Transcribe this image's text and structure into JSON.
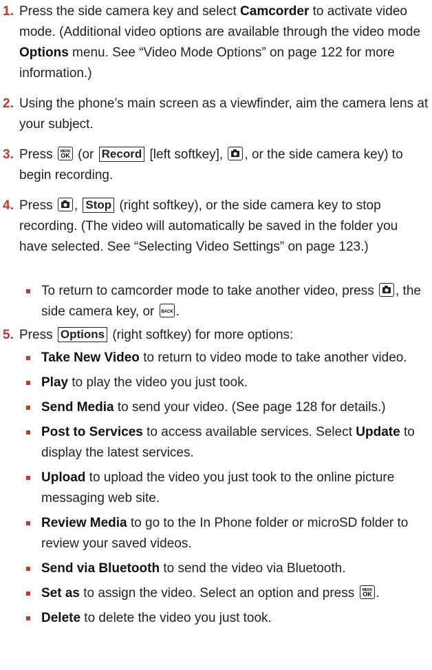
{
  "colors": {
    "accent": "#c0392b",
    "text": "#222222"
  },
  "icons": {
    "menu_ok": "menu-ok-key-icon",
    "camera": "camera-key-icon",
    "back": "back-key-icon"
  },
  "steps": [
    {
      "num": "1.",
      "a": "Press the side camera key and select ",
      "b": "Camcorder",
      "c": " to activate video mode. (Additional video options are available through the video mode ",
      "d": "Options",
      "e": " menu. See “Video Mode Options” on page 122 for more information.)"
    },
    {
      "num": "2.",
      "a": "Using the phone’s main screen as a viewfinder, aim the camera lens at your subject."
    },
    {
      "num": "3.",
      "a": "Press ",
      "b": " (or ",
      "softkey": "Record",
      "c": " [left softkey], ",
      "d": ", or the side camera key) to begin recording."
    },
    {
      "num": "4.",
      "a": "Press ",
      "b": ", ",
      "softkey": "Stop",
      "c": " (right softkey), or the side camera key to stop recording. (The video will automatically be saved in the folder you have selected. See “Selecting Video Settings” on page 123.)",
      "sub_a": "To return to camcorder mode to take another video, press ",
      "sub_b": ", the side camera key, or ",
      "sub_c": "."
    },
    {
      "num": "5.",
      "a": "Press ",
      "softkey": "Options",
      "b": " (right softkey) for more options:"
    }
  ],
  "options": [
    {
      "label": "Take New Video",
      "desc": " to return to video mode to take another video."
    },
    {
      "label": "Play",
      "desc": " to play the video you just took."
    },
    {
      "label": "Send Media",
      "desc": " to send your video. (See page 128 for details.)"
    },
    {
      "label": "Post to Services",
      "desc": " to access available services. Select ",
      "label2": "Update",
      "desc2": " to display the latest services."
    },
    {
      "label": "Upload",
      "desc": " to upload the video you just took to the online picture messaging web site."
    },
    {
      "label": "Review Media",
      "desc": " to go to the In Phone folder or microSD folder to review your saved videos."
    },
    {
      "label": "Send via Bluetooth",
      "desc": " to send the video via Bluetooth."
    },
    {
      "label": "Set as",
      "desc": " to assign the video. Select an option and press ",
      "desc_end": "."
    },
    {
      "label": "Delete",
      "desc": " to delete the video you just took."
    }
  ]
}
